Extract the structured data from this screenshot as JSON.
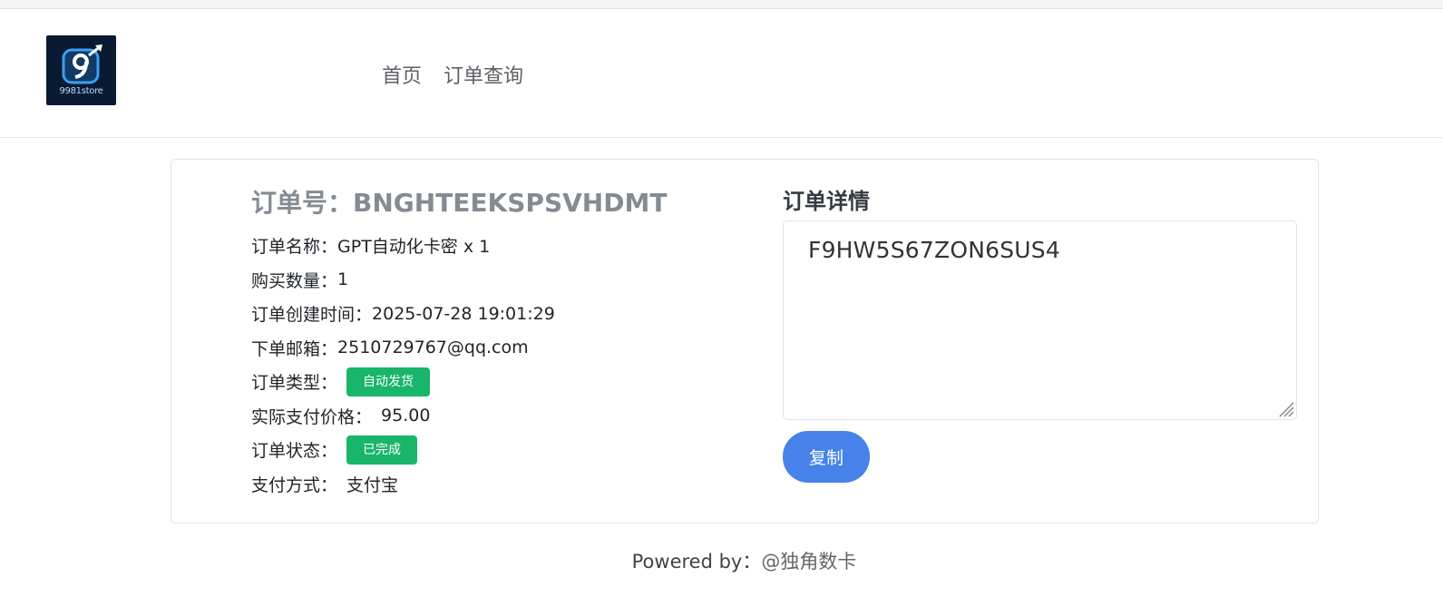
{
  "header": {
    "logo_text": "9981store",
    "nav": [
      "首页",
      "订单查询"
    ]
  },
  "order": {
    "order_no_label": "订单号：",
    "order_no": "BNGHTEEKSPSVHDMT",
    "rows": [
      {
        "label": "订单名称：",
        "value": "GPT自动化卡密 x 1"
      },
      {
        "label": "购买数量：",
        "value": "1"
      },
      {
        "label": "订单创建时间：",
        "value": "2025-07-28 19:01:29"
      },
      {
        "label": "下单邮箱：",
        "value": "2510729767@qq.com"
      },
      {
        "label": "订单类型：",
        "badge": "自动发货"
      },
      {
        "label": "实际支付价格：",
        "value": "95.00"
      },
      {
        "label": "订单状态：",
        "badge": "已完成"
      },
      {
        "label": "支付方式：",
        "value": "支付宝"
      }
    ]
  },
  "detail": {
    "title": "订单详情",
    "content": "F9HW5S67ZON6SUS4",
    "copy_label": "复制"
  },
  "footer": {
    "prefix": "Powered by：",
    "brand": "@独角数卡"
  },
  "colors": {
    "badge_green": "#18b56a",
    "button_blue": "#4682ea"
  }
}
